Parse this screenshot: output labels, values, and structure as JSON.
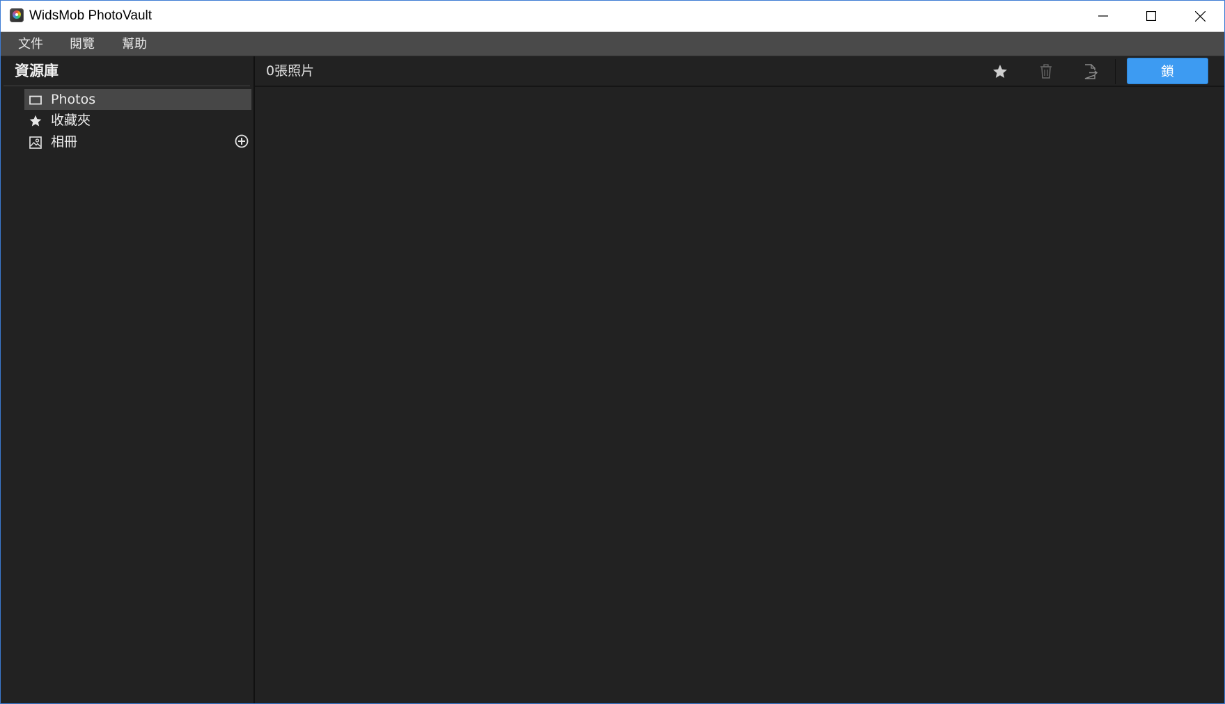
{
  "window": {
    "title": "WidsMob PhotoVault"
  },
  "menubar": {
    "items": [
      {
        "label": "文件"
      },
      {
        "label": "閱覽"
      },
      {
        "label": "幫助"
      }
    ]
  },
  "sidebar": {
    "title": "資源庫",
    "items": [
      {
        "label": "Photos",
        "icon": "photo-frame-icon",
        "selected": true
      },
      {
        "label": "收藏夾",
        "icon": "star-icon",
        "selected": false
      },
      {
        "label": "相冊",
        "icon": "album-icon",
        "selected": false
      }
    ],
    "add_album_icon": "plus-circle-icon"
  },
  "main": {
    "photo_count_text": "0張照片",
    "toolbar": {
      "favorite_icon": "star-icon",
      "delete_icon": "trash-icon",
      "export_icon": "export-icon",
      "lock_label": "鎖"
    }
  },
  "colors": {
    "background": "#222222",
    "menubar": "#4a4a4a",
    "selected_item": "#474747",
    "accent": "#3d9bf2",
    "window_border": "#3c7bd4"
  }
}
